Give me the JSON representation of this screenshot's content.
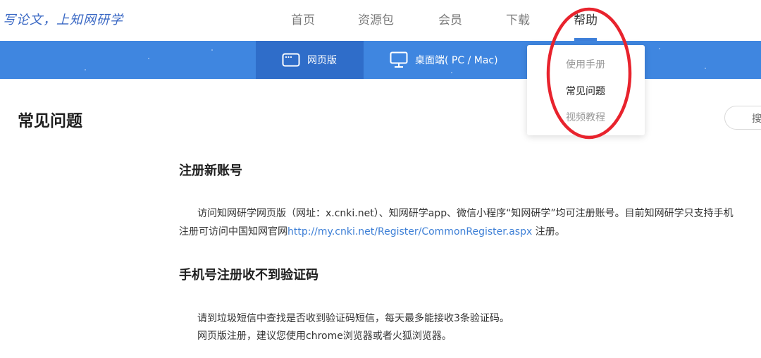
{
  "logo": {
    "text": "写论文，上知网研学"
  },
  "nav": {
    "items": [
      {
        "label": "首页"
      },
      {
        "label": "资源包"
      },
      {
        "label": "会员"
      },
      {
        "label": "下载"
      },
      {
        "label": "帮助"
      }
    ],
    "active": "帮助"
  },
  "tabs": {
    "web": {
      "label": "网页版",
      "icon": "browser-window-icon"
    },
    "desktop": {
      "label": "桌面端( PC / Mac)",
      "icon": "monitor-icon"
    }
  },
  "help_menu": {
    "items": [
      {
        "label": "使用手册"
      },
      {
        "label": "常见问题"
      },
      {
        "label": "视频教程"
      }
    ],
    "selected": "常见问题"
  },
  "annotation": {
    "color": "#e8232d"
  },
  "page": {
    "title": "常见问题"
  },
  "search": {
    "label": "搜"
  },
  "sections": [
    {
      "title": "注册新账号",
      "line1": "访问知网研学网页版（网址：x.cnki.net）、知网研学app、微信小程序“知网研学”均可注册账号。目前知网研学只支持手机",
      "line2_before": "注册可访问中国知网官网",
      "line2_link": "http://my.cnki.net/Register/CommonRegister.aspx",
      "line2_after": " 注册。"
    },
    {
      "title": "手机号注册收不到验证码",
      "line1": "请到垃圾短信中查找是否收到验证码短信，每天最多能接收3条验证码。",
      "line2": "网页版注册，建议您使用chrome浏览器或者火狐浏览器。"
    }
  ],
  "colors": {
    "primary": "#3f86e0",
    "active_tab": "#2f6dc9",
    "link": "#3d7fd6"
  }
}
